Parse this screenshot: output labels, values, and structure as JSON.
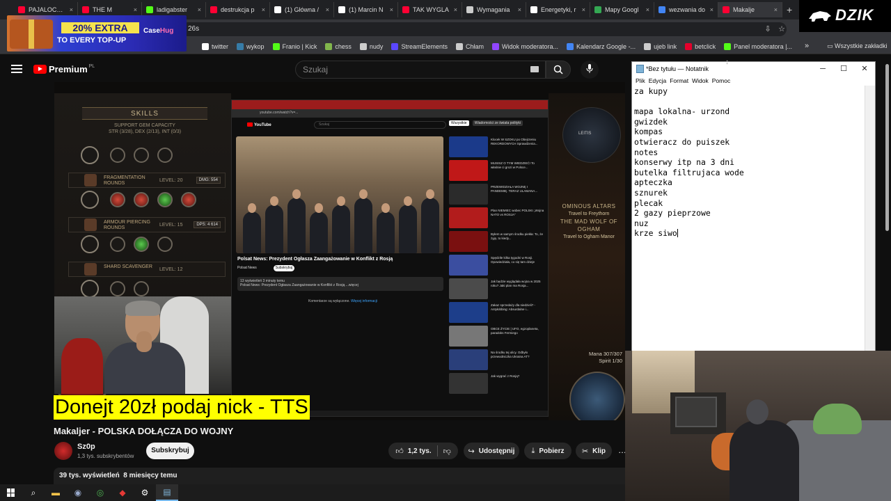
{
  "browser": {
    "tabs": [
      {
        "label": "PAJALOCK C",
        "color": "#ff0033"
      },
      {
        "label": "THE M",
        "color": "#ff0033"
      },
      {
        "label": "ladigabster",
        "color": "#53fc18"
      },
      {
        "label": "destrukcja p",
        "color": "#ff0033"
      },
      {
        "label": "(1) Główna /",
        "color": "#ffffff"
      },
      {
        "label": "(1) Marcin N",
        "color": "#ffffff"
      },
      {
        "label": "TAK WYGLA",
        "color": "#ff0033"
      },
      {
        "label": "Wymagania",
        "color": "#cccccc"
      },
      {
        "label": "Energetyki, r",
        "color": "#ffffff"
      },
      {
        "label": "Mapy Googl",
        "color": "#34a853"
      },
      {
        "label": "wezwania do",
        "color": "#4285f4"
      },
      {
        "label": "Makalje",
        "color": "#ff0033"
      }
    ],
    "new_tab": "+",
    "address_fragment": "26s",
    "bookmarks": [
      {
        "label": "twitter",
        "color": "#ffffff"
      },
      {
        "label": "wykop",
        "color": "#367ca8"
      },
      {
        "label": "Franio | Kick",
        "color": "#53fc18"
      },
      {
        "label": "chess",
        "color": "#81b64c"
      },
      {
        "label": "nudy",
        "color": "#cccccc"
      },
      {
        "label": "StreamElements",
        "color": "#5b47ff"
      },
      {
        "label": "Chłam",
        "color": "#cccccc"
      },
      {
        "label": "Widok moderatora...",
        "color": "#9146ff"
      },
      {
        "label": "Kalendarz Google -...",
        "color": "#4285f4"
      },
      {
        "label": "ujeb link",
        "color": "#cccccc"
      },
      {
        "label": "betclick",
        "color": "#e4002b"
      },
      {
        "label": "Panel moderatora |...",
        "color": "#53fc18"
      }
    ],
    "bookmarks_more": "»",
    "all_bookmarks": "Wszystkie zakładki"
  },
  "ad": {
    "line1": "20% EXTRA",
    "line2": "TO EVERY TOP-UP",
    "brand_a": "Case",
    "brand_b": "Hug"
  },
  "logo": {
    "text": "DZIK"
  },
  "youtube": {
    "premium": "Premium",
    "region": "PL",
    "search_placeholder": "Szukaj",
    "video_title": "Makaljer - POLSKA DOŁĄCZA DO WOJNY",
    "channel_name": "Sz0p",
    "channel_subs": "1,3 tys. subskrybentów",
    "subscribe": "Subskrybuj",
    "likes": "1,2 tys.",
    "share": "Udostępnij",
    "download": "Pobierz",
    "clip": "Klip",
    "more": "…",
    "views_date": "39 tys. wyświetleń  8 miesięcy temu"
  },
  "overlay": {
    "tts": "Donejt 20zł podaj nick - TTS"
  },
  "game": {
    "skills_header": "SKILLS",
    "skills_sub": "SUPPORT GEM CAPACITY\nSTR (3/28), DEX (2/13), INT (0/3)",
    "skill1": "FRAGMENTATION ROUNDS",
    "skill1_level": "LEVEL: 20",
    "skill1_stat": "DMG: 554",
    "skill2": "ARMOUR PIERCING ROUNDS",
    "skill2_level": "LEVEL: 15",
    "skill2_stat": "DPS: 4 614",
    "skill3": "SHARD SCAVENGER",
    "skill3_level": "LEVEL: 12",
    "zone_title": "OMINOUS ALTARS",
    "zone_l2": "Travel to Freythorn",
    "zone_l3": "THE MAD WOLF OF OGHAM",
    "zone_l4": "Travel to Ogham Manor",
    "map_label": "LEITIS",
    "mana": "Mana 307/307",
    "spirit": "Spirit 1/30"
  },
  "inner": {
    "url": "youtube.com/watch?v=...",
    "logo": "YouTube",
    "search": "Szukaj",
    "chip1": "Wszystkie",
    "chip2": "Wiadomości ze świata polityki",
    "video_title": "Polsat News: Prezydent Ogłasza Zaangażowanie w Konflikt z Rosją",
    "channel": "Polsat News",
    "subscribe": "Subskrybuj",
    "desc": "13 wyświetleń  3 minuty temu\nPolsat News: Prezydent Ogłasza Zaangażowanie w Konflikt z Rosją ...więcej",
    "comments_a": "Komentarze są wyłączone.",
    "comments_b": "Więcej informacji",
    "recs": [
      {
        "title": "Klocek W SZOKU po Obejrzeniu REKORDOWYCH Sprawdzenia...",
        "color": "#1b3a8a"
      },
      {
        "title": "MUSISZ O TYM WIEDZIEĆ! To właśnie ci grozi w Polsce...",
        "color": "#c01818"
      },
      {
        "title": "PRZEWIDZIAŁA WOJNĘ I PANDEMIĘ. TERAZ ULAMANA...",
        "color": "#2b2b2b"
      },
      {
        "title": "Plan NIEMIEC wobec POLSKI „Wojna NATO vs ROSJA”",
        "color": "#b21c1c"
      },
      {
        "title": "Byłem w samym środku piekła: To, że żyję, to kiedy...",
        "color": "#7a1010"
      },
      {
        "title": "Spędziłe kilka tygodni w Rosji. Opowiedziała, co się tam dzieje",
        "color": "#3b4ea0"
      },
      {
        "title": "Jak będzie wyglądała wojna w 2025 roku? Jaki plan ma Rosja...",
        "color": "#4b4b4b"
      },
      {
        "title": "Zakaz sprzedaży dla niedzieli? - Antyłobbing: Absurdalne i...",
        "color": "#1d3e8a"
      },
      {
        "title": "OBCE ŻYCIE | UFO, egzoplaneta, paradoks Fermiego",
        "color": "#777777"
      },
      {
        "title": "Na środku tej ulicy. Odbyło przewodniczka Ukraina AT?",
        "color": "#2a3f7a"
      },
      {
        "title": "Jak wygrać z Rosją?",
        "color": "#333333"
      }
    ]
  },
  "notepad": {
    "title": "*Bez tytułu — Notatnik",
    "menu": [
      "Plik",
      "Edycja",
      "Format",
      "Widok",
      "Pomoc"
    ],
    "minimize": "─",
    "maximize": "☐",
    "close": "✕",
    "lines": [
      "za kupy",
      "",
      "mapa lokalna- urzond",
      "gwizdek",
      "kompas",
      "otwieracz do puiszek",
      "notes",
      "konserwy itp na 3 dni",
      "butelka filtrujaca wode",
      "apteczka",
      "sznurek",
      "plecak",
      "2 gazy pieprzowe",
      "nuz",
      "krze siwo"
    ]
  }
}
